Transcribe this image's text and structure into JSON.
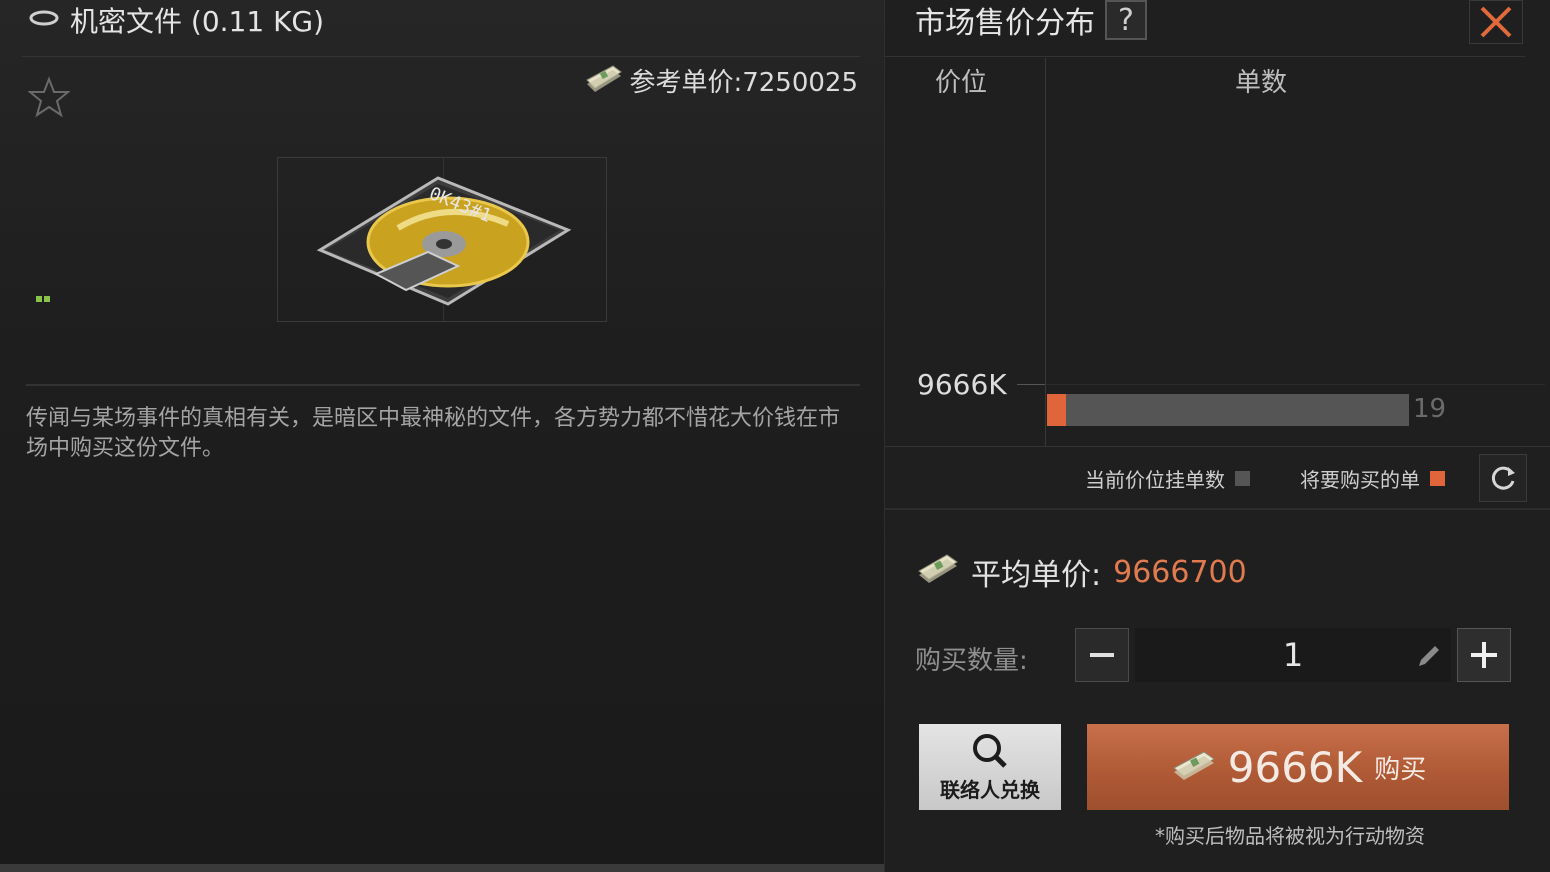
{
  "item": {
    "title": "机密文件 (0.11 KG)",
    "ref_price_label": "参考单价:7250025",
    "description": "传闻与某场事件的真相有关，是暗区中最神秘的文件，各方势力都不惜花大价钱在市场中购买这份文件。"
  },
  "market": {
    "title": "市场售价分布",
    "help": "?",
    "col_price": "价位",
    "col_count": "单数",
    "legend_current": "当前价位挂单数",
    "legend_buy": "将要购买的单",
    "colors": {
      "current": "#555555",
      "buy": "#e0653a"
    }
  },
  "chart_data": {
    "type": "bar",
    "orientation": "horizontal",
    "categories": [
      "9666K"
    ],
    "series": [
      {
        "name": "当前价位挂单数",
        "values": [
          19
        ]
      },
      {
        "name": "将要购买的单",
        "values": [
          1
        ]
      }
    ]
  },
  "purchase": {
    "avg_label": "平均单价:",
    "avg_value": "9666700",
    "qty_label": "购买数量:",
    "qty_value": "1",
    "contact_label": "联络人兑换",
    "buy_amount": "9666K",
    "buy_label": "购买",
    "note": "*购买后物品将被视为行动物资"
  },
  "icons": {
    "close": "close-icon",
    "refresh": "refresh-icon",
    "search": "search-icon",
    "edit": "pencil-icon",
    "star": "star-icon",
    "money": "money-icon",
    "weight": "ring-icon"
  }
}
